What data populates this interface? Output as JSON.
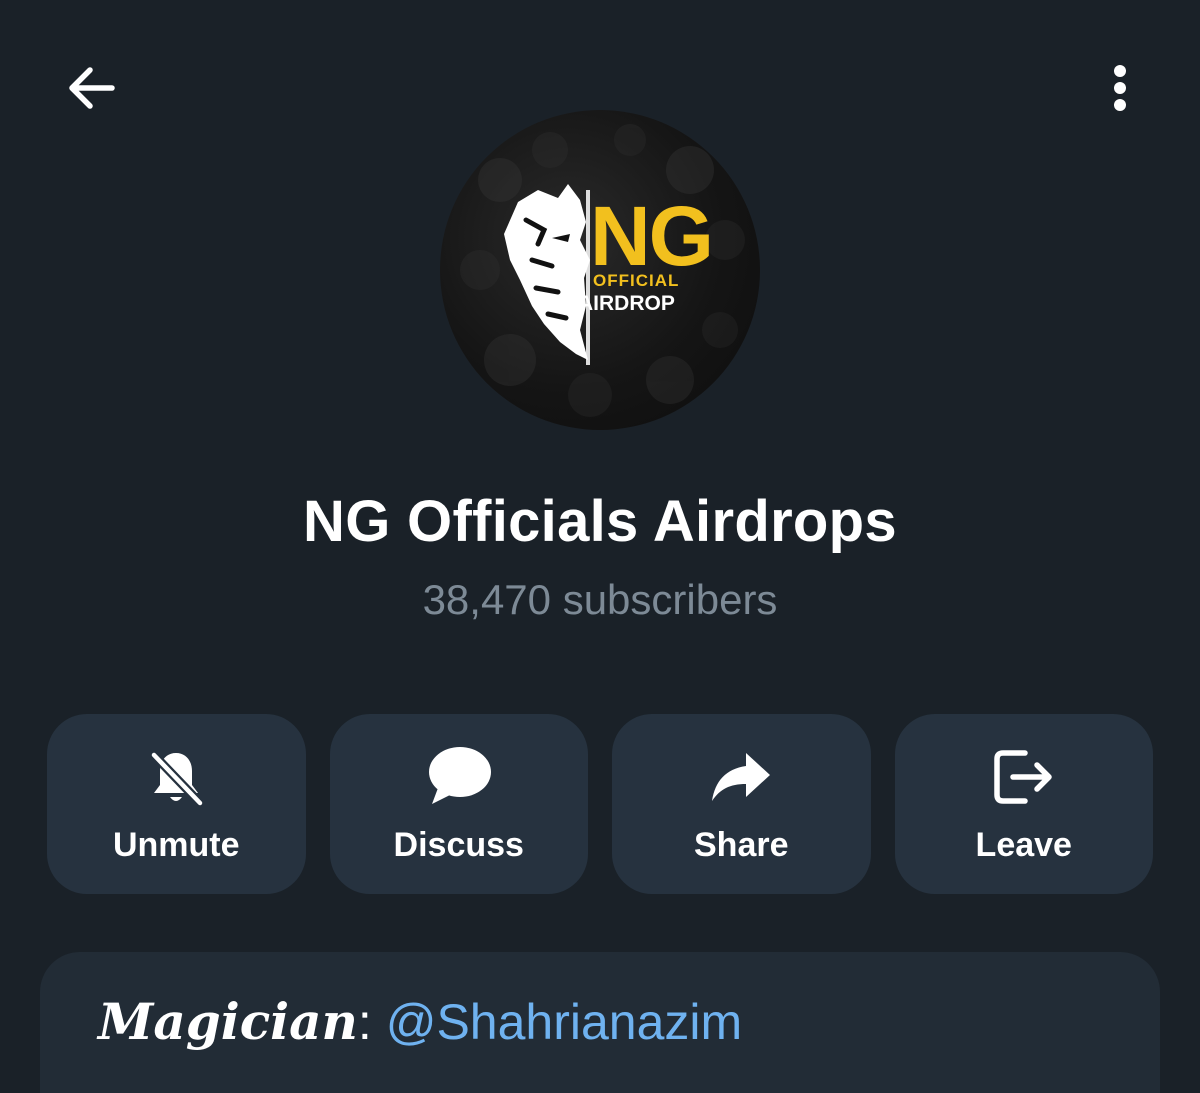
{
  "header": {
    "back_icon": "arrow-left-icon",
    "menu_icon": "more-vertical-icon"
  },
  "channel": {
    "avatar_logo_text": "NG",
    "avatar_logo_sub1": "OFFICIAL",
    "avatar_logo_sub2": "AIRDROP",
    "title": "NG Officials Airdrops",
    "subscribers": "38,470 subscribers"
  },
  "actions": [
    {
      "label": "Unmute",
      "icon": "bell-off-icon"
    },
    {
      "label": "Discuss",
      "icon": "chat-bubble-icon"
    },
    {
      "label": "Share",
      "icon": "share-arrow-icon"
    },
    {
      "label": "Leave",
      "icon": "leave-icon"
    }
  ],
  "info": {
    "key": "Magician",
    "colon": ":",
    "link": "@Shahrianazim"
  },
  "colors": {
    "background": "#1a2128",
    "button_bg": "#26323f",
    "link": "#6fb2f0",
    "logo_yellow": "#f2c01e"
  }
}
